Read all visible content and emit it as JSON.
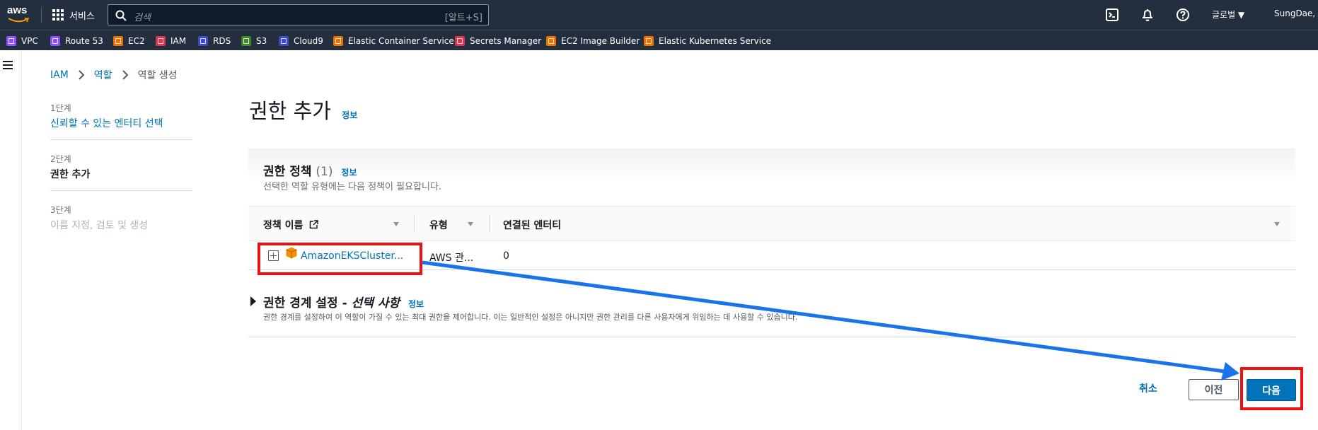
{
  "topnav": {
    "logo_text": "aws",
    "services_label": "서비스",
    "search_placeholder": "검색",
    "search_shortcut": "[알트+S]",
    "region_label": "글로벌 ▼",
    "user_label": "SungDae, K"
  },
  "favorites": [
    {
      "label": "VPC",
      "color": "#8c4fff"
    },
    {
      "label": "Route 53",
      "color": "#8c4fff"
    },
    {
      "label": "EC2",
      "color": "#ed7100"
    },
    {
      "label": "IAM",
      "color": "#dd344c"
    },
    {
      "label": "RDS",
      "color": "#3b48cc"
    },
    {
      "label": "S3",
      "color": "#3f8624"
    },
    {
      "label": "Cloud9",
      "color": "#3b48cc"
    },
    {
      "label": "Elastic Container Service",
      "color": "#ed7100"
    },
    {
      "label": "Secrets Manager",
      "color": "#dd344c"
    },
    {
      "label": "EC2 Image Builder",
      "color": "#ed7100"
    },
    {
      "label": "Elastic Kubernetes Service",
      "color": "#ed7100"
    }
  ],
  "breadcrumb": {
    "items": [
      "IAM",
      "역할",
      "역할 생성"
    ]
  },
  "steps": [
    {
      "label": "1단계",
      "title": "신뢰할 수 있는 엔터티 선택"
    },
    {
      "label": "2단계",
      "title": "권한 추가"
    },
    {
      "label": "3단계",
      "title": "이름 지정, 검토 및 생성"
    }
  ],
  "page": {
    "title": "권한 추가",
    "info": "정보"
  },
  "policies": {
    "title": "권한 정책",
    "count": "(1)",
    "info": "정보",
    "description": "선택한 역할 유형에는 다음 정책이 필요합니다.",
    "columns": [
      "정책 이름",
      "유형",
      "연결된 엔터티"
    ],
    "rows": [
      {
        "name": "AmazonEKSCluster...",
        "type": "AWS 관...",
        "entities": "0"
      }
    ]
  },
  "boundary": {
    "title": "권한 경계 설정 - ",
    "title_optional": "선택 사항",
    "info": "정보",
    "description": "권한 경계를 설정하여 이 역할이 가질 수 있는 최대 권한을 제어합니다. 이는 일반적인 설정은 아니지만 권한 관리를 다른 사용자에게 위임하는 데 사용할 수 있습니다."
  },
  "footer": {
    "cancel": "취소",
    "previous": "이전",
    "next": "다음"
  },
  "colors": {
    "annotation": "#ee1111",
    "arrow": "#1a73e8",
    "primary": "#0073bb",
    "nav_bg": "#232f3e"
  }
}
